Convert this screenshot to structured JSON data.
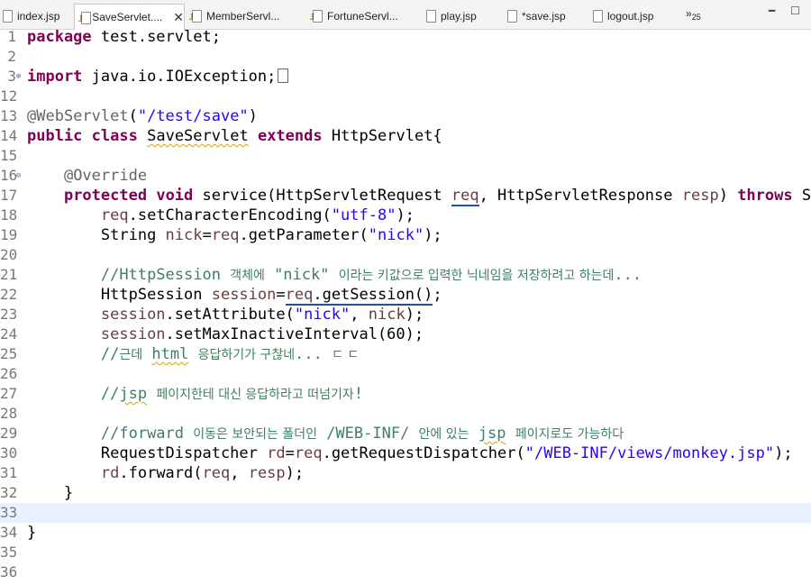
{
  "tabs": [
    {
      "label": "index.jsp",
      "active": false
    },
    {
      "label": "SaveServlet....",
      "active": true,
      "close": "✕"
    },
    {
      "label": "MemberServl...",
      "active": false
    },
    {
      "label": "FortuneServl...",
      "active": false
    },
    {
      "label": "play.jsp",
      "active": false
    },
    {
      "label": "*save.jsp",
      "active": false
    },
    {
      "label": "logout.jsp",
      "active": false
    }
  ],
  "overflow": {
    "chevron": "»",
    "count": "25"
  },
  "window_controls": {
    "minimize": "━",
    "maximize": "☐"
  },
  "editor": {
    "current_line": "33",
    "lines": [
      {
        "num": "1"
      },
      {
        "num": "2"
      },
      {
        "num": "3"
      },
      {
        "num": "12"
      },
      {
        "num": "13"
      },
      {
        "num": "14"
      },
      {
        "num": "15"
      },
      {
        "num": "16"
      },
      {
        "num": "17"
      },
      {
        "num": "18"
      },
      {
        "num": "19"
      },
      {
        "num": "20"
      },
      {
        "num": "21"
      },
      {
        "num": "22"
      },
      {
        "num": "23"
      },
      {
        "num": "24"
      },
      {
        "num": "25"
      },
      {
        "num": "26"
      },
      {
        "num": "27"
      },
      {
        "num": "28"
      },
      {
        "num": "29"
      },
      {
        "num": "30"
      },
      {
        "num": "31"
      },
      {
        "num": "32"
      },
      {
        "num": "33"
      },
      {
        "num": "34"
      },
      {
        "num": "35"
      },
      {
        "num": "36"
      }
    ],
    "code": {
      "l1": {
        "kw": "package",
        "rest": " test.servlet;"
      },
      "l3": {
        "kw": "import",
        "rest": " java.io.IOException;"
      },
      "l13": {
        "ann": "@WebServlet",
        "open": "(",
        "str": "\"/test/save\"",
        "close": ")"
      },
      "l14": {
        "kw1": "public",
        "kw2": "class",
        "name": "SaveServlet",
        "kw3": "extends",
        "rest": " HttpServlet{"
      },
      "l16": {
        "ann": "@Override"
      },
      "l17": {
        "kw1": "protected",
        "kw2": "void",
        "a": " service(HttpServletRequest ",
        "p1": "req",
        "b": ", HttpServletResponse ",
        "p2": "resp",
        "c": ") ",
        "kw3": "throws",
        "d": " Ser"
      },
      "l18": {
        "v": "req",
        "a": ".setCharacterEncoding(",
        "str": "\"utf-8\"",
        "b": ");"
      },
      "l19": {
        "a": "String ",
        "v1": "nick",
        "b": "=",
        "v2": "req",
        "c": ".getParameter(",
        "str": "\"nick\"",
        "d": ");"
      },
      "l21": {
        "a": "//HttpSession ",
        "k1": "객체에",
        "b": " \"nick\" ",
        "k2": "이라는 키값으로 입력한 닉네임을 저장하려고 하는데",
        "c": "..."
      },
      "l22": {
        "a": "HttpSession ",
        "v1": "session",
        "b": "=",
        "v2": "req",
        "c": ".getSession()",
        "d": ";"
      },
      "l23": {
        "v": "session",
        "a": ".setAttribute(",
        "str": "\"nick\"",
        "b": ", ",
        "v2": "nick",
        "c": ");"
      },
      "l24": {
        "v": "session",
        "a": ".setMaxInactiveInterval(60);"
      },
      "l25": {
        "a": "//",
        "k1": "근데",
        "b": " ",
        "sq": "html",
        "c": " ",
        "k2": "응답하기가 구찮네",
        "d": "... ",
        "k3": "ㄷ ㄷ"
      },
      "l27": {
        "a": "//",
        "sq": "jsp",
        "b": " ",
        "k1": "페이지한테 대신 응답하라고 떠넘기자",
        "c": "!"
      },
      "l29": {
        "a": "//forward ",
        "k1": "이동은 보안되는 폴더인",
        "b": " /WEB-INF/ ",
        "k2": "안에 있는",
        "c": " ",
        "sq": "jsp",
        "d": " ",
        "k3": "페이지로도 가능하다"
      },
      "l30": {
        "a": "RequestDispatcher ",
        "v1": "rd",
        "b": "=",
        "v2": "req",
        "c": ".getRequestDispatcher(",
        "str": "\"/WEB-INF/views/monkey.jsp\"",
        "d": ");"
      },
      "l31": {
        "v1": "rd",
        "a": ".forward(",
        "v2": "req",
        "b": ", ",
        "v3": "resp",
        "c": ");"
      },
      "l32": {
        "a": "}"
      },
      "l34": {
        "a": "}"
      }
    }
  }
}
